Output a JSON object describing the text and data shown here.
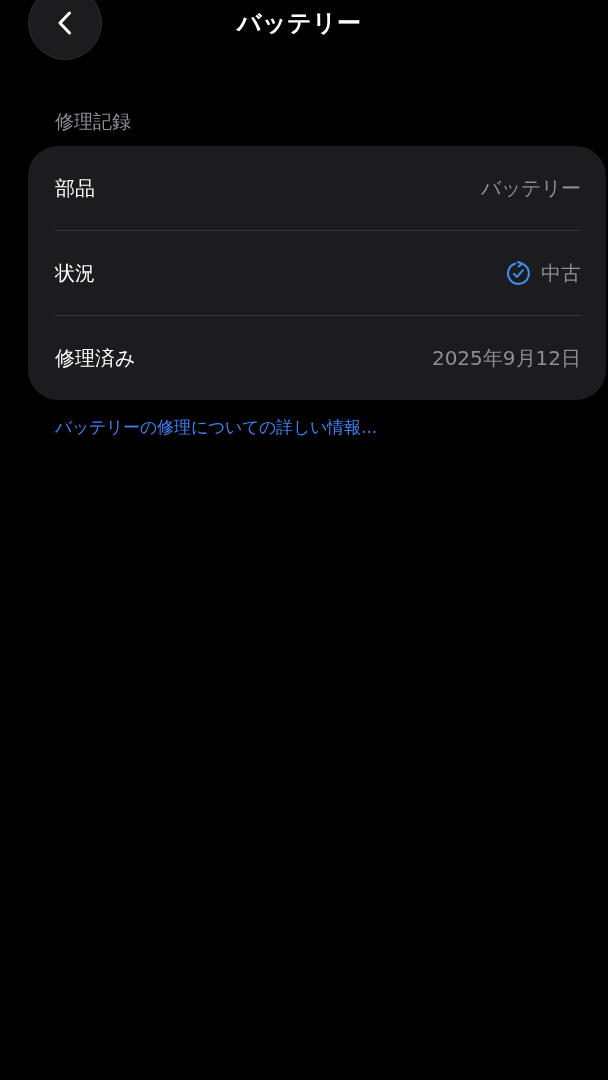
{
  "header": {
    "title": "バッテリー"
  },
  "section": {
    "title": "修理記録",
    "rows": [
      {
        "kind": "text",
        "label": "部品",
        "value": "バッテリー"
      },
      {
        "kind": "status",
        "label": "状況",
        "value": "中古"
      },
      {
        "kind": "text",
        "label": "修理済み",
        "value": "2025年9月12日"
      }
    ]
  },
  "link": "バッテリーの修理についての詳しい情報..."
}
